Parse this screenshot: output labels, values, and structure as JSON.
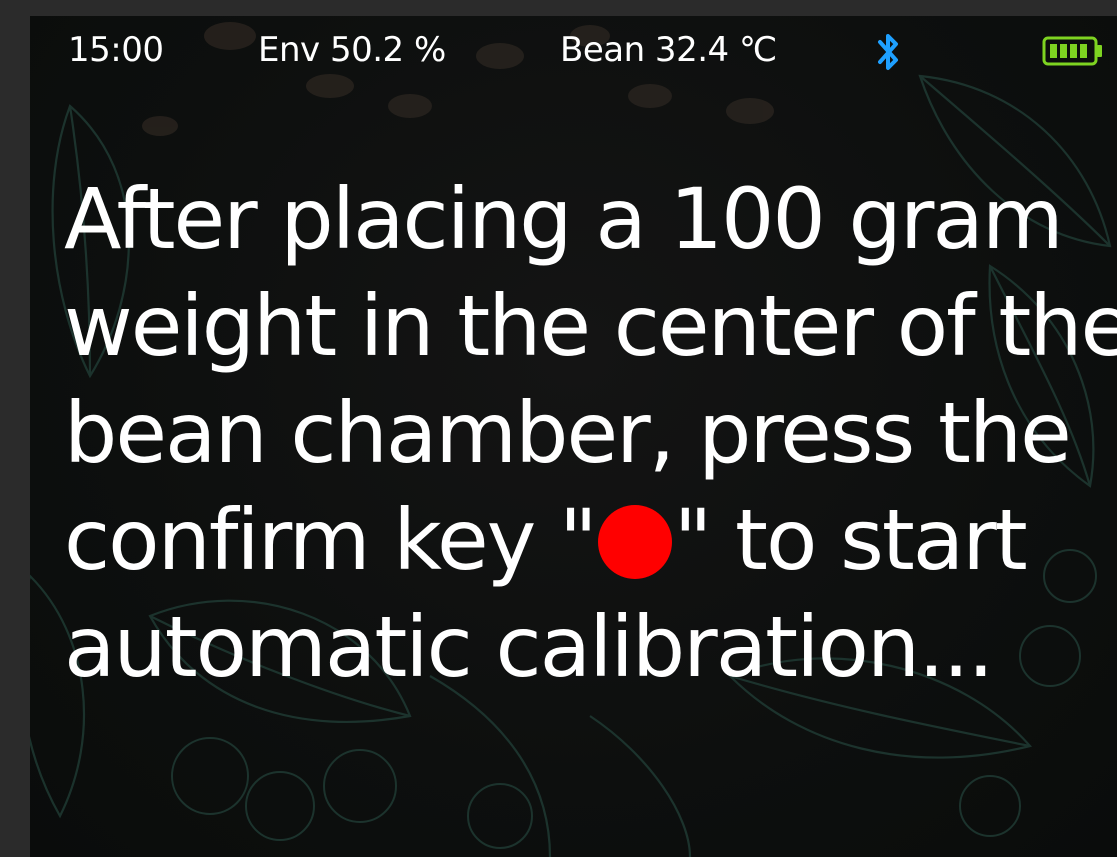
{
  "status_bar": {
    "time": "15:00",
    "env": "Env 50.2  %",
    "bean": "Bean 32.4  ℃",
    "bluetooth_icon": "bluetooth-icon",
    "battery_icon": "battery-full-icon"
  },
  "message": {
    "line1": "After placing a 100 gram",
    "line2": "weight in the center of the",
    "line3": "bean chamber, press the",
    "line4_before": "confirm key \"",
    "line4_key_icon": "red-dot-icon",
    "line4_after": "\"  to start",
    "line5": "automatic calibration..."
  },
  "colors": {
    "text": "#ffffff",
    "confirm_key": "#ff0000",
    "bluetooth": "#1ea0ff",
    "battery": "#7ed321",
    "background": "#0d0f0e",
    "leaf_art": "#1f3a33"
  }
}
